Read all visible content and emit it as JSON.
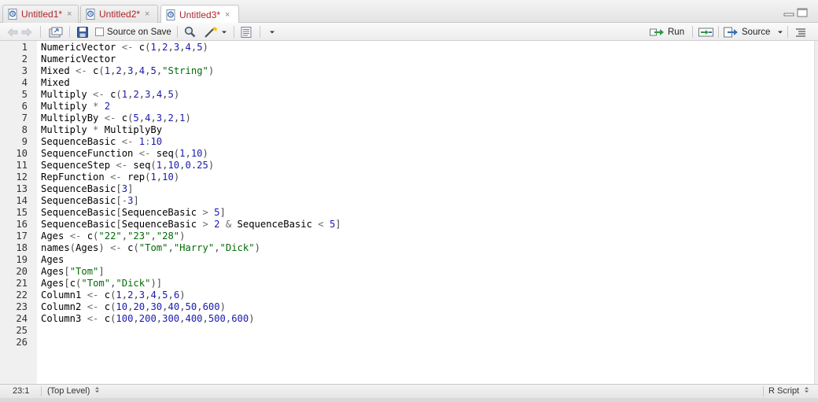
{
  "tabs": [
    {
      "name": "Untitled1*",
      "close": "×"
    },
    {
      "name": "Untitled2*",
      "close": "×"
    },
    {
      "name": "Untitled3*",
      "close": "×"
    }
  ],
  "toolbar": {
    "source_on_save": "Source on Save",
    "run": "Run",
    "source": "Source"
  },
  "lines": [
    [
      [
        "id",
        "NumericVector "
      ],
      [
        "op",
        "<- "
      ],
      [
        "id",
        "c"
      ],
      [
        "par",
        "("
      ],
      [
        "num",
        "1"
      ],
      [
        "par",
        ","
      ],
      [
        "num",
        "2"
      ],
      [
        "par",
        ","
      ],
      [
        "num",
        "3"
      ],
      [
        "par",
        ","
      ],
      [
        "num",
        "4"
      ],
      [
        "par",
        ","
      ],
      [
        "num",
        "5"
      ],
      [
        "par",
        ")"
      ]
    ],
    [
      [
        "id",
        "NumericVector"
      ]
    ],
    [
      [
        "id",
        "Mixed "
      ],
      [
        "op",
        "<- "
      ],
      [
        "id",
        "c"
      ],
      [
        "par",
        "("
      ],
      [
        "num",
        "1"
      ],
      [
        "par",
        ","
      ],
      [
        "num",
        "2"
      ],
      [
        "par",
        ","
      ],
      [
        "num",
        "3"
      ],
      [
        "par",
        ","
      ],
      [
        "num",
        "4"
      ],
      [
        "par",
        ","
      ],
      [
        "num",
        "5"
      ],
      [
        "par",
        ","
      ],
      [
        "str",
        "\"String\""
      ],
      [
        "par",
        ")"
      ]
    ],
    [
      [
        "id",
        "Mixed"
      ]
    ],
    [
      [
        "id",
        "Multiply "
      ],
      [
        "op",
        "<- "
      ],
      [
        "id",
        "c"
      ],
      [
        "par",
        "("
      ],
      [
        "num",
        "1"
      ],
      [
        "par",
        ","
      ],
      [
        "num",
        "2"
      ],
      [
        "par",
        ","
      ],
      [
        "num",
        "3"
      ],
      [
        "par",
        ","
      ],
      [
        "num",
        "4"
      ],
      [
        "par",
        ","
      ],
      [
        "num",
        "5"
      ],
      [
        "par",
        ")"
      ]
    ],
    [
      [
        "id",
        "Multiply "
      ],
      [
        "op",
        "* "
      ],
      [
        "num",
        "2"
      ]
    ],
    [
      [
        "id",
        "MultiplyBy "
      ],
      [
        "op",
        "<- "
      ],
      [
        "id",
        "c"
      ],
      [
        "par",
        "("
      ],
      [
        "num",
        "5"
      ],
      [
        "par",
        ","
      ],
      [
        "num",
        "4"
      ],
      [
        "par",
        ","
      ],
      [
        "num",
        "3"
      ],
      [
        "par",
        ","
      ],
      [
        "num",
        "2"
      ],
      [
        "par",
        ","
      ],
      [
        "num",
        "1"
      ],
      [
        "par",
        ")"
      ]
    ],
    [
      [
        "id",
        "Multiply "
      ],
      [
        "op",
        "* "
      ],
      [
        "id",
        "MultiplyBy"
      ]
    ],
    [
      [
        "id",
        "SequenceBasic "
      ],
      [
        "op",
        "<- "
      ],
      [
        "num",
        "1"
      ],
      [
        "op",
        ":"
      ],
      [
        "num",
        "10"
      ]
    ],
    [
      [
        "id",
        "SequenceFunction "
      ],
      [
        "op",
        "<- "
      ],
      [
        "id",
        "seq"
      ],
      [
        "par",
        "("
      ],
      [
        "num",
        "1"
      ],
      [
        "par",
        ","
      ],
      [
        "num",
        "10"
      ],
      [
        "par",
        ")"
      ]
    ],
    [
      [
        "id",
        "SequenceStep "
      ],
      [
        "op",
        "<- "
      ],
      [
        "id",
        "seq"
      ],
      [
        "par",
        "("
      ],
      [
        "num",
        "1"
      ],
      [
        "par",
        ","
      ],
      [
        "num",
        "10"
      ],
      [
        "par",
        ","
      ],
      [
        "num",
        "0.25"
      ],
      [
        "par",
        ")"
      ]
    ],
    [
      [
        "id",
        "RepFunction "
      ],
      [
        "op",
        "<- "
      ],
      [
        "id",
        "rep"
      ],
      [
        "par",
        "("
      ],
      [
        "num",
        "1"
      ],
      [
        "par",
        ","
      ],
      [
        "num",
        "10"
      ],
      [
        "par",
        ")"
      ]
    ],
    [
      [
        "id",
        "SequenceBasic"
      ],
      [
        "par",
        "["
      ],
      [
        "num",
        "3"
      ],
      [
        "par",
        "]"
      ]
    ],
    [
      [
        "id",
        "SequenceBasic"
      ],
      [
        "par",
        "["
      ],
      [
        "op",
        "-"
      ],
      [
        "num",
        "3"
      ],
      [
        "par",
        "]"
      ]
    ],
    [
      [
        "id",
        "SequenceBasic"
      ],
      [
        "par",
        "["
      ],
      [
        "id",
        "SequenceBasic "
      ],
      [
        "op",
        "> "
      ],
      [
        "num",
        "5"
      ],
      [
        "par",
        "]"
      ]
    ],
    [
      [
        "id",
        "SequenceBasic"
      ],
      [
        "par",
        "["
      ],
      [
        "id",
        "SequenceBasic "
      ],
      [
        "op",
        "> "
      ],
      [
        "num",
        "2 "
      ],
      [
        "op",
        "& "
      ],
      [
        "id",
        "SequenceBasic "
      ],
      [
        "op",
        "< "
      ],
      [
        "num",
        "5"
      ],
      [
        "par",
        "]"
      ]
    ],
    [
      [
        "id",
        "Ages "
      ],
      [
        "op",
        "<- "
      ],
      [
        "id",
        "c"
      ],
      [
        "par",
        "("
      ],
      [
        "str",
        "\"22\""
      ],
      [
        "par",
        ","
      ],
      [
        "str",
        "\"23\""
      ],
      [
        "par",
        ","
      ],
      [
        "str",
        "\"28\""
      ],
      [
        "par",
        ")"
      ]
    ],
    [
      [
        "id",
        "names"
      ],
      [
        "par",
        "("
      ],
      [
        "id",
        "Ages"
      ],
      [
        "par",
        ") "
      ],
      [
        "op",
        "<- "
      ],
      [
        "id",
        "c"
      ],
      [
        "par",
        "("
      ],
      [
        "str",
        "\"Tom\""
      ],
      [
        "par",
        ","
      ],
      [
        "str",
        "\"Harry\""
      ],
      [
        "par",
        ","
      ],
      [
        "str",
        "\"Dick\""
      ],
      [
        "par",
        ")"
      ]
    ],
    [
      [
        "id",
        "Ages"
      ]
    ],
    [
      [
        "id",
        "Ages"
      ],
      [
        "par",
        "["
      ],
      [
        "str",
        "\"Tom\""
      ],
      [
        "par",
        "]"
      ]
    ],
    [
      [
        "id",
        "Ages"
      ],
      [
        "par",
        "["
      ],
      [
        "id",
        "c"
      ],
      [
        "par",
        "("
      ],
      [
        "str",
        "\"Tom\""
      ],
      [
        "par",
        ","
      ],
      [
        "str",
        "\"Dick\""
      ],
      [
        "par",
        ")]"
      ]
    ],
    [
      [
        "id",
        "Column1 "
      ],
      [
        "op",
        "<- "
      ],
      [
        "id",
        "c"
      ],
      [
        "par",
        "("
      ],
      [
        "num",
        "1"
      ],
      [
        "par",
        ","
      ],
      [
        "num",
        "2"
      ],
      [
        "par",
        ","
      ],
      [
        "num",
        "3"
      ],
      [
        "par",
        ","
      ],
      [
        "num",
        "4"
      ],
      [
        "par",
        ","
      ],
      [
        "num",
        "5"
      ],
      [
        "par",
        ","
      ],
      [
        "num",
        "6"
      ],
      [
        "par",
        ")"
      ]
    ],
    [
      [
        "id",
        "Column2 "
      ],
      [
        "op",
        "<- "
      ],
      [
        "id",
        "c"
      ],
      [
        "par",
        "("
      ],
      [
        "num",
        "10"
      ],
      [
        "par",
        ","
      ],
      [
        "num",
        "20"
      ],
      [
        "par",
        ","
      ],
      [
        "num",
        "30"
      ],
      [
        "par",
        ","
      ],
      [
        "num",
        "40"
      ],
      [
        "par",
        ","
      ],
      [
        "num",
        "50"
      ],
      [
        "par",
        ","
      ],
      [
        "num",
        "600"
      ],
      [
        "par",
        ")"
      ]
    ],
    [
      [
        "id",
        "Column3 "
      ],
      [
        "op",
        "<- "
      ],
      [
        "id",
        "c"
      ],
      [
        "par",
        "("
      ],
      [
        "num",
        "100"
      ],
      [
        "par",
        ","
      ],
      [
        "num",
        "200"
      ],
      [
        "par",
        ","
      ],
      [
        "num",
        "300"
      ],
      [
        "par",
        ","
      ],
      [
        "num",
        "400"
      ],
      [
        "par",
        ","
      ],
      [
        "num",
        "500"
      ],
      [
        "par",
        ","
      ],
      [
        "num",
        "600"
      ],
      [
        "par",
        ")"
      ]
    ],
    [],
    []
  ],
  "line_numbers": [
    "1",
    "2",
    "3",
    "4",
    "5",
    "6",
    "7",
    "8",
    "9",
    "10",
    "11",
    "12",
    "13",
    "14",
    "15",
    "16",
    "17",
    "18",
    "19",
    "20",
    "21",
    "22",
    "23",
    "24",
    "25",
    "26"
  ],
  "status": {
    "cursor": "23:1",
    "scope": "(Top Level)",
    "file_type": "R Script"
  },
  "icons": {
    "file": "r-file-icon",
    "back": "back-arrow-icon",
    "forward": "forward-arrow-icon",
    "save": "save-icon",
    "search": "search-icon",
    "wand": "magic-wand-icon"
  },
  "colors": {
    "tab_text": "#b0262b",
    "number": "#1a1ab0",
    "string": "#036a07",
    "operator": "#6b6b6b",
    "gutter_bg": "#f0f0f0"
  }
}
